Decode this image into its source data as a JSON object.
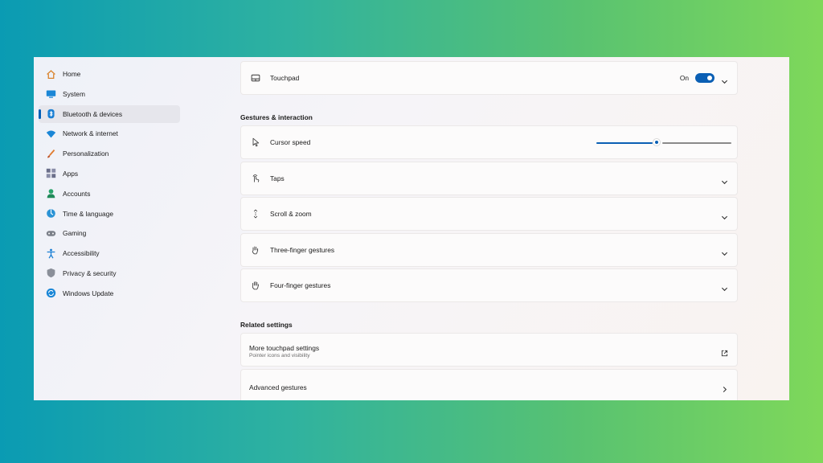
{
  "sidebar": {
    "items": [
      {
        "label": "Home",
        "icon": "home-icon"
      },
      {
        "label": "System",
        "icon": "system-icon"
      },
      {
        "label": "Bluetooth & devices",
        "icon": "bluetooth-icon"
      },
      {
        "label": "Network & internet",
        "icon": "wifi-icon"
      },
      {
        "label": "Personalization",
        "icon": "brush-icon"
      },
      {
        "label": "Apps",
        "icon": "apps-icon"
      },
      {
        "label": "Accounts",
        "icon": "accounts-icon"
      },
      {
        "label": "Time & language",
        "icon": "globe-icon"
      },
      {
        "label": "Gaming",
        "icon": "gamepad-icon"
      },
      {
        "label": "Accessibility",
        "icon": "accessibility-icon"
      },
      {
        "label": "Privacy & security",
        "icon": "shield-icon"
      },
      {
        "label": "Windows Update",
        "icon": "update-icon"
      }
    ],
    "active": "Bluetooth & devices"
  },
  "touchpad": {
    "label": "Touchpad",
    "state": "On",
    "enabled": true
  },
  "gestures": {
    "title": "Gestures & interaction",
    "cursor_speed": {
      "label": "Cursor speed",
      "value": 0.45
    },
    "taps": "Taps",
    "scroll_zoom": "Scroll & zoom",
    "three_finger": "Three-finger gestures",
    "four_finger": "Four-finger gestures"
  },
  "related": {
    "title": "Related settings",
    "more_touchpad": {
      "title": "More touchpad settings",
      "subtitle": "Pointer icons and visibility"
    },
    "advanced": "Advanced gestures"
  },
  "colors": {
    "accent": "#0a5fb4"
  }
}
